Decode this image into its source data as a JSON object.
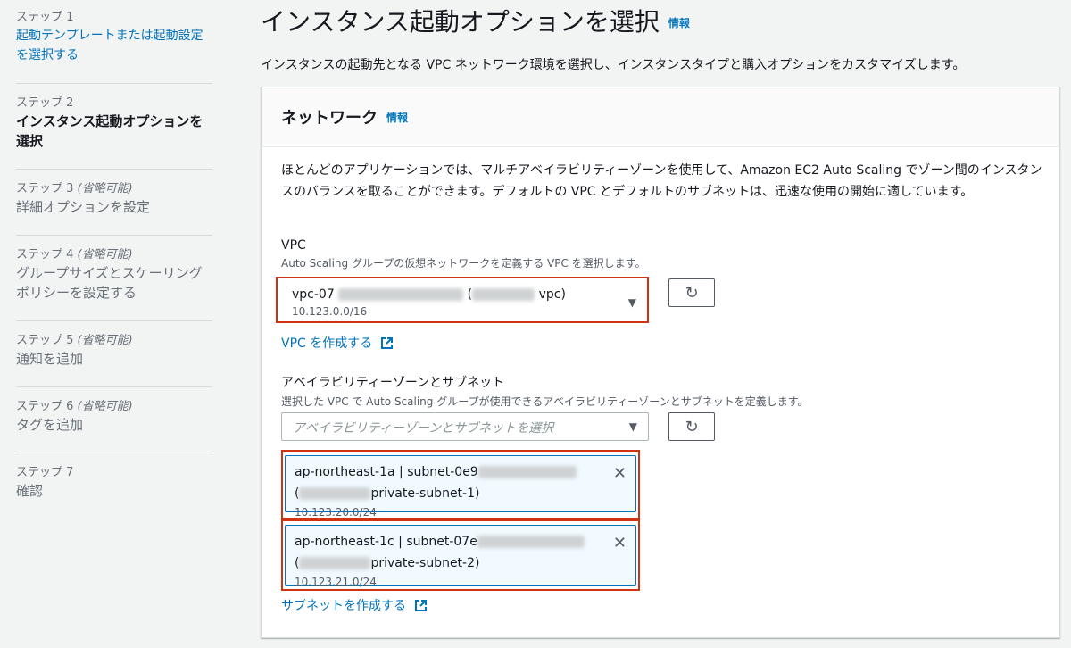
{
  "sidebar": {
    "steps": [
      {
        "num": "ステップ 1",
        "optional": "",
        "title": "起動テンプレートまたは起動設定を選択する"
      },
      {
        "num": "ステップ 2",
        "optional": "",
        "title": "インスタンス起動オプションを選択"
      },
      {
        "num": "ステップ 3",
        "optional": "(省略可能)",
        "title": "詳細オプションを設定"
      },
      {
        "num": "ステップ 4",
        "optional": "(省略可能)",
        "title": "グループサイズとスケーリングポリシーを設定する"
      },
      {
        "num": "ステップ 5",
        "optional": "(省略可能)",
        "title": "通知を追加"
      },
      {
        "num": "ステップ 6",
        "optional": "(省略可能)",
        "title": "タグを追加"
      },
      {
        "num": "ステップ 7",
        "optional": "",
        "title": "確認"
      }
    ]
  },
  "page": {
    "title": "インスタンス起動オプションを選択",
    "info": "情報",
    "description": "インスタンスの起動先となる VPC ネットワーク環境を選択し、インスタンスタイプと購入オプションをカスタマイズします。"
  },
  "network": {
    "title": "ネットワーク",
    "info": "情報",
    "body": "ほとんどのアプリケーションでは、マルチアベイラビリティーゾーンを使用して、Amazon EC2 Auto Scaling でゾーン間のインスタンスのバランスを取ることができます。デフォルトの VPC とデフォルトのサブネットは、迅速な使用の開始に適しています。",
    "vpc": {
      "label": "VPC",
      "description": "Auto Scaling グループの仮想ネットワークを定義する VPC を選択します。",
      "selected_prefix": "vpc-07",
      "selected_suffix": "vpc)",
      "selected_cidr": "10.123.0.0/16",
      "create_link": "VPC を作成する"
    },
    "subnets": {
      "label": "アベイラビリティーゾーンとサブネット",
      "description": "選択した VPC で Auto Scaling グループが使用できるアベイラビリティーゾーンとサブネットを定義します。",
      "placeholder": "アベイラビリティーゾーンとサブネットを選択",
      "tokens": [
        {
          "line1": "ap-northeast-1a | subnet-0e9",
          "line2_prefix": "(",
          "line2_suffix": "private-subnet-1)",
          "cidr": "10.123.20.0/24"
        },
        {
          "line1": "ap-northeast-1c | subnet-07e",
          "line2_prefix": "(",
          "line2_suffix": "private-subnet-2)",
          "cidr": "10.123.21.0/24"
        }
      ],
      "create_link": "サブネットを作成する"
    }
  }
}
